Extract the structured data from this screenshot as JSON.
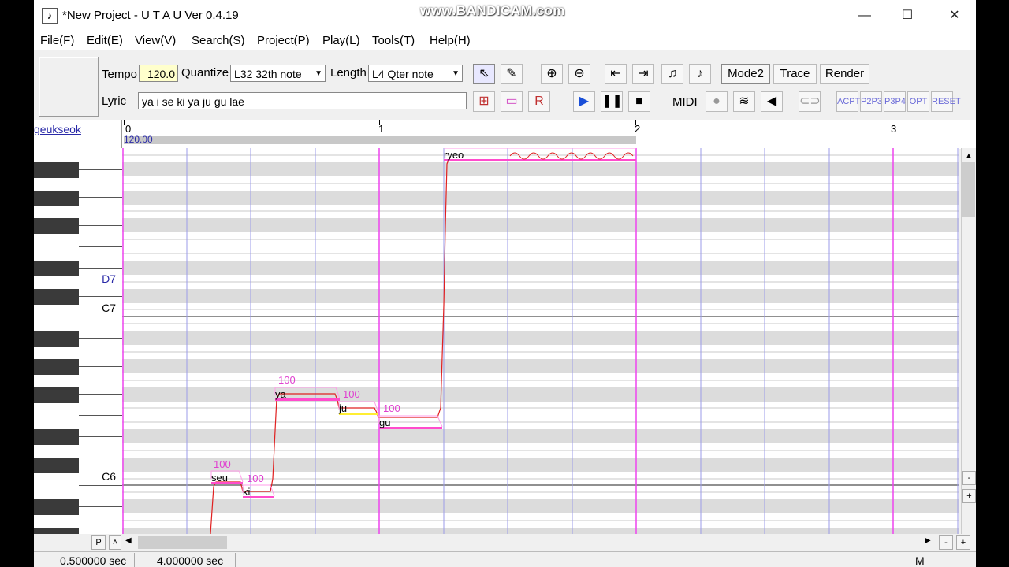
{
  "window": {
    "title": "*New Project - U T A U Ver 0.4.19",
    "icon": "music-note-icon",
    "controls": [
      "minimize-icon",
      "maximize-icon",
      "close-icon"
    ]
  },
  "watermark": "www.BANDICAM.com",
  "menu": [
    "File(F)",
    "Edit(E)",
    "View(V)",
    "Search(S)",
    "Project(P)",
    "Play(L)",
    "Tools(T)",
    "Help(H)"
  ],
  "toolbar": {
    "tempo_label": "Tempo",
    "tempo_value": "120.0",
    "quantize_label": "Quantize",
    "quantize_value": "L32 32th note",
    "length_label": "Length",
    "length_value": "L4  Qter note",
    "lyric_label": "Lyric",
    "lyric_value": "ya i se ki ya ju gu lae",
    "mode2_label": "Mode2",
    "trace_label": "Trace",
    "render_label": "Render",
    "midi_label": "MIDI",
    "small_icons": [
      "ACPT",
      "P2P3",
      "P3P4",
      "OPT",
      "RESET"
    ]
  },
  "header": {
    "singer": "geukseok",
    "tempo_marker": "120.00",
    "measures": [
      "0",
      "1",
      "2",
      "3"
    ]
  },
  "keys": {
    "labels": [
      "D7",
      "C7",
      "C6"
    ]
  },
  "notes": [
    {
      "lyric": "seu",
      "velocity": "100"
    },
    {
      "lyric": "ki",
      "velocity": "100"
    },
    {
      "lyric": "ya",
      "velocity": "100"
    },
    {
      "lyric": "ju",
      "velocity": "100"
    },
    {
      "lyric": "gu",
      "velocity": "100"
    },
    {
      "lyric": "ryeo",
      "velocity": ""
    }
  ],
  "scroll": {
    "p_button": "P",
    "zoom_out": "-",
    "zoom_in": "+"
  },
  "status": {
    "position": "0.500000 sec",
    "length": "4.000000 sec",
    "mode": "M"
  },
  "colors": {
    "note": "#ff4ccc",
    "note_selected": "#ffee33",
    "pitch_line": "#e02020",
    "velocity_text": "#e040d0",
    "measure_line": "#ee44ee",
    "beat_line": "#9b9be8"
  }
}
